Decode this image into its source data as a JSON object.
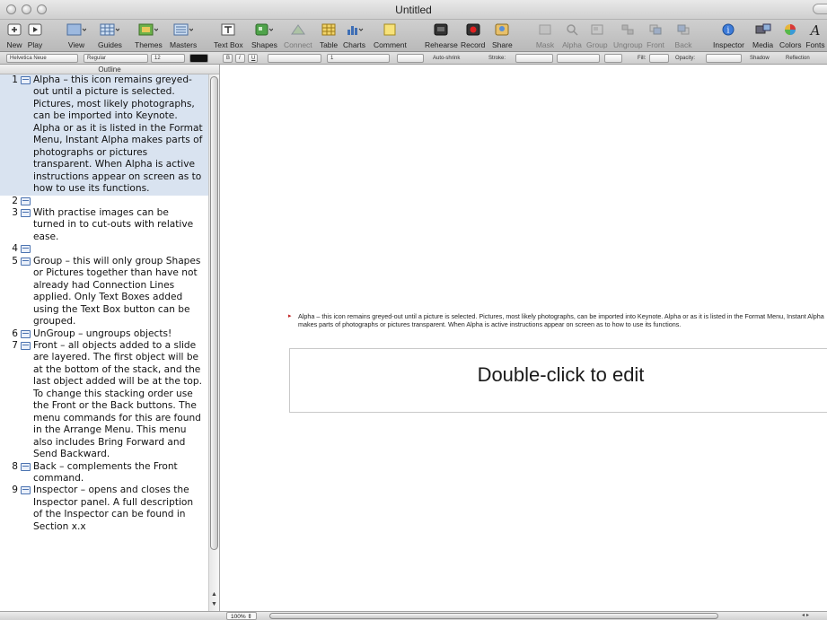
{
  "window": {
    "title": "Untitled"
  },
  "toolbar": {
    "items": [
      {
        "label": "New",
        "icon": "new-slide-icon"
      },
      {
        "label": "Play",
        "icon": "play-icon"
      },
      {
        "label": "View",
        "icon": "view-icon"
      },
      {
        "label": "Guides",
        "icon": "guides-icon"
      },
      {
        "label": "Themes",
        "icon": "themes-icon"
      },
      {
        "label": "Masters",
        "icon": "masters-icon"
      },
      {
        "label": "Text Box",
        "icon": "text-box-icon"
      },
      {
        "label": "Shapes",
        "icon": "shapes-icon"
      },
      {
        "label": "Connect",
        "icon": "connect-icon"
      },
      {
        "label": "Table",
        "icon": "table-icon"
      },
      {
        "label": "Charts",
        "icon": "charts-icon"
      },
      {
        "label": "Comment",
        "icon": "comment-icon"
      },
      {
        "label": "Rehearse",
        "icon": "rehearse-icon"
      },
      {
        "label": "Record",
        "icon": "record-icon"
      },
      {
        "label": "Share",
        "icon": "share-icon"
      },
      {
        "label": "Mask",
        "icon": "mask-icon"
      },
      {
        "label": "Alpha",
        "icon": "alpha-icon"
      },
      {
        "label": "Group",
        "icon": "group-icon"
      },
      {
        "label": "Ungroup",
        "icon": "ungroup-icon"
      },
      {
        "label": "Front",
        "icon": "front-icon"
      },
      {
        "label": "Back",
        "icon": "back-icon"
      },
      {
        "label": "Inspector",
        "icon": "inspector-icon"
      },
      {
        "label": "Media",
        "icon": "media-icon"
      },
      {
        "label": "Colors",
        "icon": "colors-icon"
      },
      {
        "label": "Fonts",
        "icon": "fonts-icon"
      }
    ]
  },
  "format_bar": {
    "font": "Helvetica Neue",
    "style": "Regular",
    "size": "12",
    "bold": "B",
    "italic": "I",
    "underline": "U",
    "line_spacing": "1",
    "autoshrink": "Auto-shrink",
    "stroke": "Stroke:",
    "fill": "Fill:",
    "opacity": "Opacity:",
    "shadow": "Shadow",
    "reflection": "Reflection"
  },
  "outline": {
    "header": "Outline",
    "items": [
      {
        "num": "1",
        "text": "Alpha – this icon remains greyed-out until a picture is selected. Pictures, most likely photographs, can be imported into Keynote. Alpha or as it is listed in the Format Menu, Instant Alpha makes parts of photographs or pictures transparent. When Alpha is active instructions appear on screen as to how to use its functions."
      },
      {
        "num": "2",
        "text": ""
      },
      {
        "num": "3",
        "text": "With practise images can be turned in to cut-outs with relative ease."
      },
      {
        "num": "4",
        "text": ""
      },
      {
        "num": "5",
        "text": "Group – this will only group Shapes or Pictures together than have not already had Connection Lines applied. Only Text Boxes added using the Text Box button can be grouped."
      },
      {
        "num": "6",
        "text": "UnGroup – ungroups objects!"
      },
      {
        "num": "7",
        "text": "Front – all objects added to a slide are layered. The first object will be at the bottom of the stack, and the last object added will be at the top. To change this stacking order use the Front or the Back buttons. The menu commands for this are found in the Arrange Menu. This menu also includes Bring Forward and Send Backward."
      },
      {
        "num": "8",
        "text": "Back – complements the Front command."
      },
      {
        "num": "9",
        "text": "Inspector – opens and closes the Inspector panel. A full description of the Inspector can be found in Section x.x"
      }
    ]
  },
  "slide": {
    "bullet": "Alpha – this icon remains greyed-out until a picture is selected. Pictures, most likely photographs, can be imported into Keynote. Alpha or as it is listed in the Format Menu, Instant Alpha makes parts of photographs or pictures transparent. When Alpha is active instructions appear on screen as to how to use its functions.",
    "placeholder": "Double-click to edit"
  },
  "status": {
    "zoom": "100%"
  }
}
